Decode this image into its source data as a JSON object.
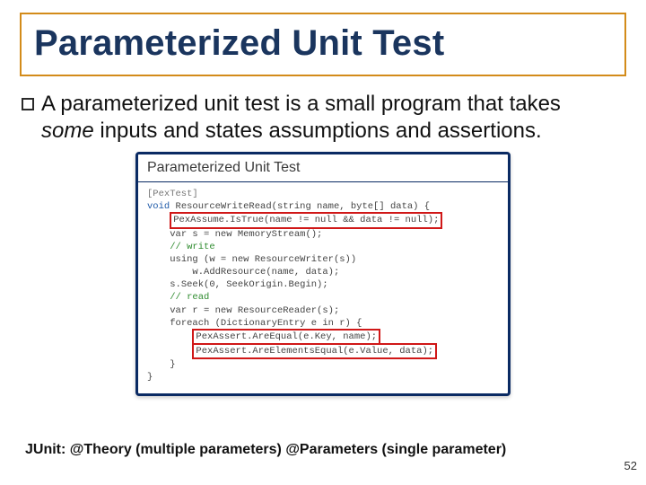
{
  "title": "Parameterized Unit Test",
  "bullet": {
    "pre": "A parameterized unit test is a small program that takes ",
    "em": "some",
    "post": " inputs and states assumptions and assertions."
  },
  "code": {
    "header": "Parameterized Unit Test",
    "attr": "[PexTest]",
    "sig_pre": "void ",
    "sig_name": "ResourceWriteRead",
    "sig_params": "(string name, byte[] data) {",
    "assume": "PexAssume.IsTrue(name != null && data != null);",
    "l_var_s": "var s = new MemoryStream();",
    "cm_write": "// write",
    "l_using": "using (w = new ResourceWriter(s))",
    "l_add": "    w.AddResource(name, data);",
    "l_seek": "s.Seek(0, SeekOrigin.Begin);",
    "cm_read": "// read",
    "l_reader": "var r = new ResourceReader(s);",
    "l_foreach": "foreach (DictionaryEntry e in r) {",
    "assert1": "PexAssert.AreEqual(e.Key, name);",
    "assert2": "PexAssert.AreElementsEqual(e.Value, data);",
    "l_close1": "}",
    "l_close2": "}"
  },
  "junit_note": "JUnit: @Theory (multiple parameters) @Parameters (single parameter)",
  "page_num": "52"
}
